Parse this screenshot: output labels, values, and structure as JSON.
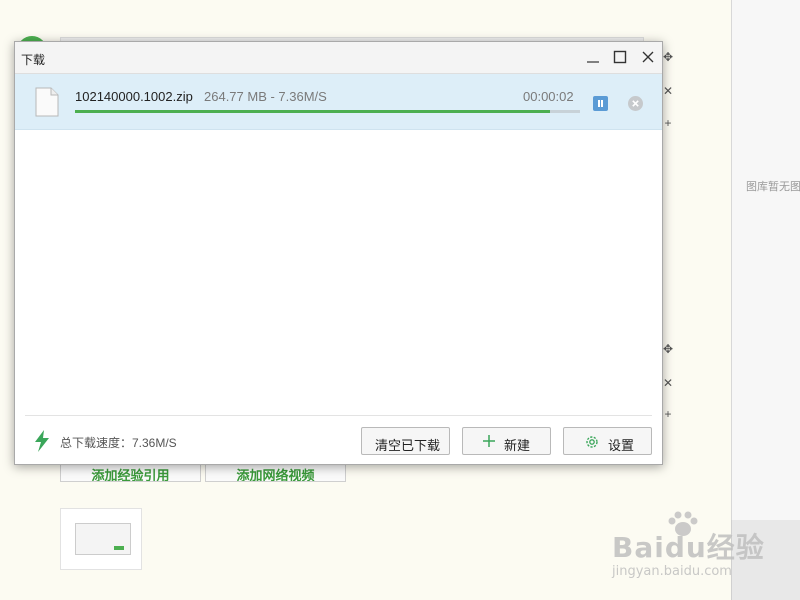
{
  "window": {
    "title": "下载",
    "controls": [
      "minimize-icon",
      "maximize-icon",
      "close-icon"
    ]
  },
  "downloads": [
    {
      "file_name": "102140000.1002.zip",
      "meta": "264.77 MB - 7.36M/S",
      "elapsed": "00:00:02",
      "progress": 0.94,
      "icon": "file-icon"
    }
  ],
  "footer": {
    "total_speed": "总下载速度：7.36M/S",
    "clear_button": "清空已下载",
    "new_button": "新建",
    "settings_button": "设置"
  },
  "background": {
    "button_left": "添加经验引用",
    "button_right": "添加网络视频",
    "gallery_empty": "图库暂无图片",
    "watermark_logo": "Baidu经验",
    "watermark_url": "jingyan.baidu.com"
  },
  "colors": {
    "accent_green": "#4caf50",
    "row_highlight": "#ddeef8",
    "pause_blue": "#5b9bd5"
  }
}
